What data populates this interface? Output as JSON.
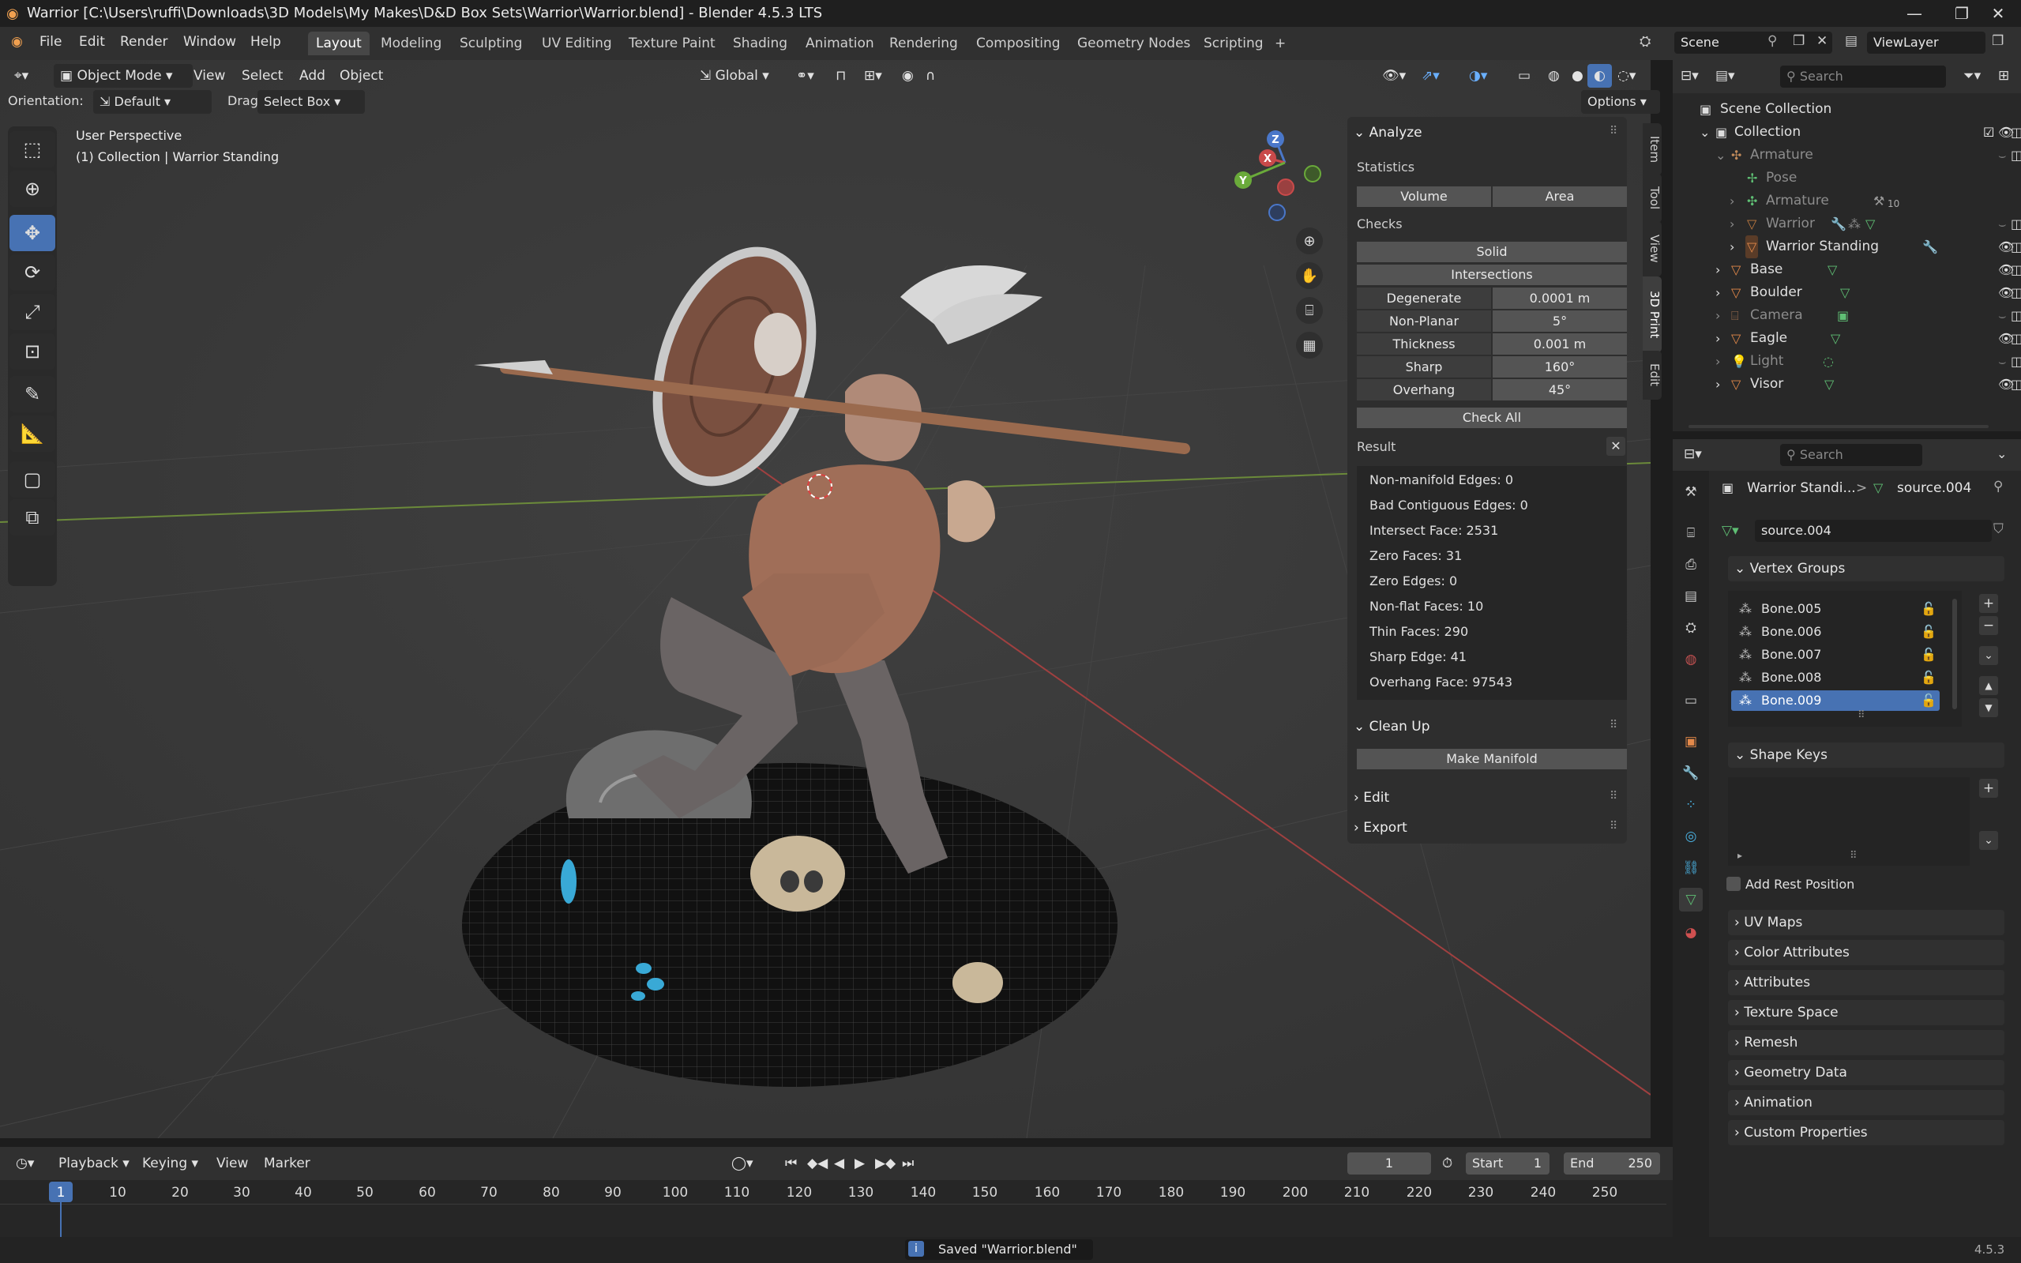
{
  "titlebar": {
    "title": "Warrior [C:\\Users\\ruffi\\Downloads\\3D Models\\My Makes\\D&D Box Sets\\Warrior\\Warrior.blend] - Blender 4.5.3 LTS",
    "minimize": "—",
    "maximize": "❐",
    "close": "✕"
  },
  "menubar": {
    "menus": [
      "File",
      "Edit",
      "Render",
      "Window",
      "Help"
    ],
    "workspaces": [
      "Layout",
      "Modeling",
      "Sculpting",
      "UV Editing",
      "Texture Paint",
      "Shading",
      "Animation",
      "Rendering",
      "Compositing",
      "Geometry Nodes",
      "Scripting"
    ],
    "active_workspace": "Layout",
    "add_workspace": "+",
    "scene": "Scene",
    "view_layer": "ViewLayer"
  },
  "viewport_header": {
    "mode": "Object Mode",
    "menus": [
      "View",
      "Select",
      "Add",
      "Object"
    ],
    "transform_orientation": "Global",
    "orientation_label": "Orientation:",
    "orientation_value": "Default",
    "drag_label": "Drag:",
    "drag_value": "Select Box",
    "options": "Options"
  },
  "viewport": {
    "view_name": "User Perspective",
    "collection_info": "(1) Collection | Warrior Standing",
    "gizmo_axes": [
      "Z",
      "X",
      "Y"
    ]
  },
  "npanel": {
    "tabs": [
      "Item",
      "Tool",
      "View",
      "3D Print",
      "Edit"
    ],
    "active_tab": "3D Print",
    "analyze": {
      "title": "Analyze",
      "statistics_label": "Statistics",
      "volume_btn": "Volume",
      "area_btn": "Area",
      "checks_label": "Checks",
      "solid_btn": "Solid",
      "intersections_btn": "Intersections",
      "checks": [
        {
          "label": "Degenerate",
          "value": "0.0001 m"
        },
        {
          "label": "Non-Planar",
          "value": "5°"
        },
        {
          "label": "Thickness",
          "value": "0.001 m"
        },
        {
          "label": "Sharp",
          "value": "160°"
        },
        {
          "label": "Overhang",
          "value": "45°"
        }
      ],
      "check_all": "Check All"
    },
    "result": {
      "title": "Result",
      "lines": [
        "Non-manifold Edges: 0",
        "Bad Contiguous Edges: 0",
        "Intersect Face: 2531",
        "Zero Faces: 31",
        "Zero Edges: 0",
        "Non-flat Faces: 10",
        "Thin Faces: 290",
        "Sharp Edge: 41",
        "Overhang Face: 97543"
      ]
    },
    "cleanup": {
      "title": "Clean Up",
      "make_manifold": "Make Manifold"
    },
    "edit": "Edit",
    "export": "Export"
  },
  "outliner": {
    "search_placeholder": "Search",
    "rows": [
      {
        "label": "Scene Collection",
        "indent": 0,
        "dim": false,
        "icon": "collection-icon"
      },
      {
        "label": "Collection",
        "indent": 1,
        "dim": false,
        "icon": "collection-icon"
      },
      {
        "label": "Armature",
        "indent": 2,
        "dim": true,
        "icon": "armature-icon"
      },
      {
        "label": "Pose",
        "indent": 3,
        "dim": true,
        "icon": "pose-icon"
      },
      {
        "label": "Armature",
        "indent": 3,
        "dim": true,
        "icon": "armature-data-icon"
      },
      {
        "label": "Warrior",
        "indent": 3,
        "dim": true,
        "icon": "mesh-icon"
      },
      {
        "label": "Warrior Standing",
        "indent": 3,
        "dim": false,
        "icon": "mesh-icon"
      },
      {
        "label": "Base",
        "indent": 2,
        "dim": false,
        "icon": "mesh-icon"
      },
      {
        "label": "Boulder",
        "indent": 2,
        "dim": false,
        "icon": "mesh-icon"
      },
      {
        "label": "Camera",
        "indent": 2,
        "dim": true,
        "icon": "camera-icon"
      },
      {
        "label": "Eagle",
        "indent": 2,
        "dim": false,
        "icon": "mesh-icon"
      },
      {
        "label": "Light",
        "indent": 2,
        "dim": true,
        "icon": "light-icon"
      },
      {
        "label": "Visor",
        "indent": 2,
        "dim": false,
        "icon": "mesh-icon"
      }
    ],
    "armature_badge": "10"
  },
  "properties": {
    "search_placeholder": "Search",
    "breadcrumb_object": "Warrior Standi...",
    "breadcrumb_sep": ">",
    "breadcrumb_data": "source.004",
    "mesh_name": "source.004",
    "vertex_groups_title": "Vertex Groups",
    "vertex_groups": [
      "Bone.005",
      "Bone.006",
      "Bone.007",
      "Bone.008",
      "Bone.009"
    ],
    "selected_vertex_group": "Bone.009",
    "shape_keys_title": "Shape Keys",
    "add_rest_position": "Add Rest Position",
    "collapsed_sections": [
      "UV Maps",
      "Color Attributes",
      "Attributes",
      "Texture Space",
      "Remesh",
      "Geometry Data",
      "Animation",
      "Custom Properties"
    ]
  },
  "timeline": {
    "menus": [
      "Playback",
      "Keying",
      "View",
      "Marker"
    ],
    "current_frame": "1",
    "start_label": "Start",
    "start": "1",
    "end_label": "End",
    "end": "250",
    "ticks": [
      "1",
      "10",
      "20",
      "30",
      "40",
      "50",
      "60",
      "70",
      "80",
      "90",
      "100",
      "110",
      "120",
      "130",
      "140",
      "150",
      "160",
      "170",
      "180",
      "190",
      "200",
      "210",
      "220",
      "230",
      "240",
      "250"
    ]
  },
  "statusbar": {
    "message": "Saved \"Warrior.blend\"",
    "version": "4.5.3"
  },
  "colors": {
    "accent": "#4772b3",
    "mesh_orange": "#e3894a",
    "mesh_green": "#5fbf74"
  }
}
